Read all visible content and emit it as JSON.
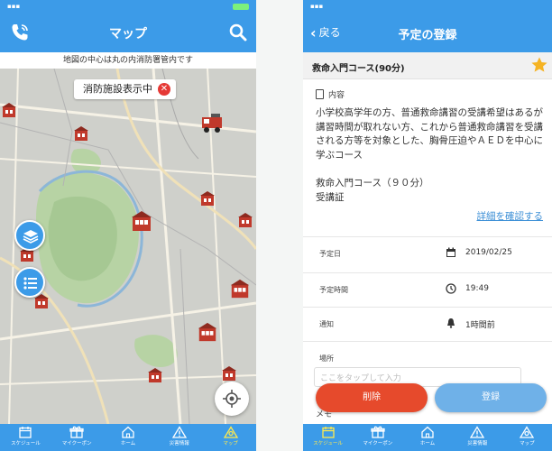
{
  "left": {
    "header": {
      "title": "マップ"
    },
    "notice": "地図の中心は丸の内消防署管内です",
    "chip": {
      "label": "消防施設表示中",
      "close": "✕"
    },
    "icons": {
      "phone": "phone-icon",
      "search": "search-icon",
      "layers": "layers-icon",
      "list": "list-icon",
      "locate": "crosshair-icon"
    },
    "tabs": [
      {
        "label": "スケジュール",
        "icon": "calendar-icon"
      },
      {
        "label": "マイクーポン",
        "icon": "gift-icon"
      },
      {
        "label": "ホーム",
        "icon": "home-icon"
      },
      {
        "label": "災害情報",
        "icon": "warning-icon"
      },
      {
        "label": "マップ",
        "icon": "map-pin-icon",
        "active": true
      }
    ]
  },
  "right": {
    "header": {
      "back": "戻る",
      "title": "予定の登録"
    },
    "course_title": "救命入門コース(90分)",
    "content_label": "内容",
    "description": "小学校高学年の方、普通救命講習の受講希望はあるが講習時間が取れない方、これから普通救命講習を受講される方等を対象とした、胸骨圧迫やＡＥＤを中心に学ぶコース",
    "course_name": "救命入門コース（９０分）",
    "certificate": "受講証",
    "detail_link": "詳細を確認する",
    "fields": [
      {
        "key": "予定日",
        "value": "2019/02/25",
        "icon": "calendar-icon"
      },
      {
        "key": "予定時間",
        "value": "19:49",
        "icon": "clock-icon"
      },
      {
        "key": "通知",
        "value": "1時間前",
        "icon": "bell-icon"
      }
    ],
    "place_label": "場所",
    "place_placeholder": "ここをタップして入力",
    "memo_label": "メモ",
    "delete_label": "削除",
    "register_label": "登録",
    "tabs": [
      {
        "label": "スケジュール",
        "icon": "calendar-icon",
        "active": true
      },
      {
        "label": "マイクーポン",
        "icon": "gift-icon"
      },
      {
        "label": "ホーム",
        "icon": "home-icon"
      },
      {
        "label": "災害情報",
        "icon": "warning-icon"
      },
      {
        "label": "マップ",
        "icon": "map-pin-icon"
      }
    ]
  },
  "colors": {
    "primary": "#3c9be8",
    "delete": "#e64a2c",
    "register": "#6fb1e8",
    "link": "#3c8fd6",
    "star": "#f5b323",
    "active_tab": "#ffe94d"
  }
}
